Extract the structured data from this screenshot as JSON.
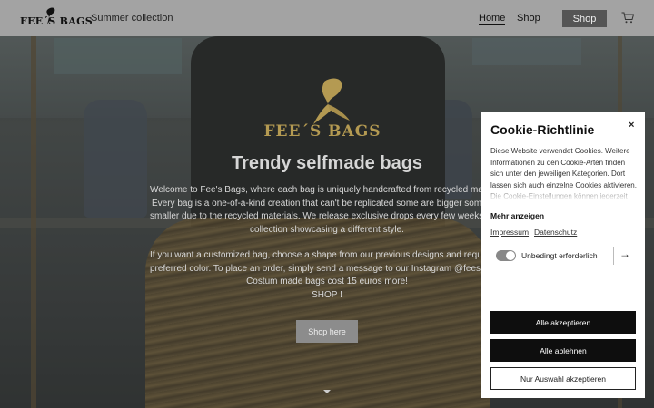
{
  "header": {
    "logo_text": "FEE´S BAGS",
    "tagline": "Summer collection",
    "nav": {
      "home": "Home",
      "shop": "Shop"
    },
    "shop_button": "Shop",
    "cart_icon": "cart-icon"
  },
  "hero": {
    "logo_text": "FEE´S BAGS",
    "title": "Trendy selfmade bags",
    "lines": [
      "Welcome to Fee's Bags, where each bag is uniquely handcrafted from recycled materials.",
      "Every bag is a one-of-a-kind creation that can't be replicated some are bigger some are",
      "smaller due to the recycled materials. We release exclusive drops every few weeks, with each",
      "collection showcasing a different style.",
      "If you want a customized bag, choose a shape from our previous designs and request your",
      "preferred color. To place an order, simply send a message to our Instagram @fees_bags.",
      "Costum made bags cost 15 euros more!",
      "SHOP !"
    ],
    "button": "Shop here"
  },
  "cookie": {
    "title": "Cookie-Richtlinie",
    "close": "×",
    "description": "Diese Website verwendet Cookies. Weitere Informationen zu den Cookie-Arten finden sich unter den jeweiligen Kategorien. Dort lassen sich auch einzelne Cookies aktivieren. Die Cookie-Einstellungen können jederzeit",
    "more": "Mehr anzeigen",
    "links": {
      "impressum": "Impressum",
      "datenschutz": "Datenschutz"
    },
    "category": "Unbedingt erforderlich",
    "buttons": {
      "accept_all": "Alle akzeptieren",
      "reject_all": "Alle ablehnen",
      "accept_selection": "Nur Auswahl akzeptieren"
    }
  }
}
